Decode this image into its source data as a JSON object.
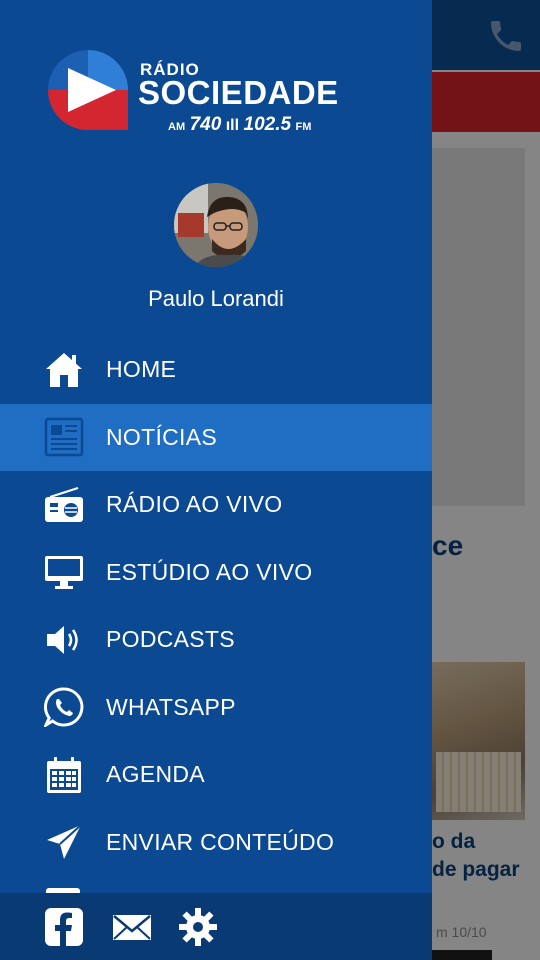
{
  "brand": {
    "radio_text": "RÁDIO",
    "name_text": "SOCIEDADE",
    "am_label": "AM",
    "am_freq": "740",
    "fm_freq": "102.5",
    "fm_label": "FM"
  },
  "user": {
    "name": "Paulo Lorandi"
  },
  "menu": {
    "items": [
      {
        "label": "HOME",
        "icon": "home-icon"
      },
      {
        "label": "NOTÍCIAS",
        "icon": "newspaper-icon"
      },
      {
        "label": "RÁDIO AO VIVO",
        "icon": "radio-icon"
      },
      {
        "label": "ESTÚDIO AO VIVO",
        "icon": "monitor-icon"
      },
      {
        "label": "PODCASTS",
        "icon": "speaker-icon"
      },
      {
        "label": "WHATSAPP",
        "icon": "whatsapp-icon"
      },
      {
        "label": "AGENDA",
        "icon": "calendar-icon"
      },
      {
        "label": "ENVIAR CONTEÚDO",
        "icon": "send-icon"
      }
    ],
    "active_index": 1
  },
  "footer": {
    "icons": [
      "facebook-icon",
      "mail-icon",
      "gear-icon"
    ]
  },
  "background": {
    "headline_fragment": "ce",
    "caption_line1": "o da",
    "caption_line2": "de pagar",
    "date_fragment": "m 10/10"
  },
  "colors": {
    "drawer_bg": "#0b4a92",
    "active_item_bg": "#1f6ec3",
    "footer_bg": "#0a3a73",
    "topbar_bg": "#0e4d94",
    "alert_bar": "#d3232b"
  }
}
